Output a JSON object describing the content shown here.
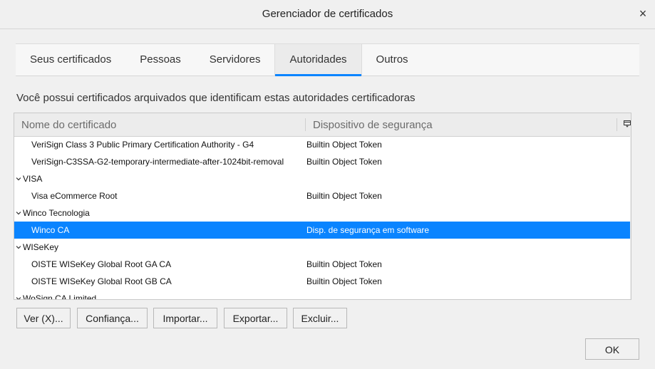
{
  "window": {
    "title": "Gerenciador de certificados",
    "close_label": "×"
  },
  "tabs": [
    {
      "label": "Seus certificados",
      "active": false
    },
    {
      "label": "Pessoas",
      "active": false
    },
    {
      "label": "Servidores",
      "active": false
    },
    {
      "label": "Autoridades",
      "active": true
    },
    {
      "label": "Outros",
      "active": false
    }
  ],
  "description": "Você possui certificados arquivados que identificam estas autoridades certificadoras",
  "table": {
    "columns": [
      "Nome do certificado",
      "Dispositivo de segurança"
    ],
    "rows": [
      {
        "type": "item",
        "name": "VeriSign Class 3 Public Primary Certification Authority - G4",
        "device": "Builtin Object Token",
        "selected": false
      },
      {
        "type": "item",
        "name": "VeriSign-C3SSA-G2-temporary-intermediate-after-1024bit-removal",
        "device": "Builtin Object Token",
        "selected": false
      },
      {
        "type": "group",
        "name": "VISA",
        "device": "",
        "selected": false
      },
      {
        "type": "item",
        "name": "Visa eCommerce Root",
        "device": "Builtin Object Token",
        "selected": false
      },
      {
        "type": "group",
        "name": "Winco Tecnologia",
        "device": "",
        "selected": false
      },
      {
        "type": "item",
        "name": "Winco CA",
        "device": "Disp. de segurança em software",
        "selected": true
      },
      {
        "type": "group",
        "name": "WISeKey",
        "device": "",
        "selected": false
      },
      {
        "type": "item",
        "name": "OISTE WISeKey Global Root GA CA",
        "device": "Builtin Object Token",
        "selected": false
      },
      {
        "type": "item",
        "name": "OISTE WISeKey Global Root GB CA",
        "device": "Builtin Object Token",
        "selected": false
      },
      {
        "type": "group",
        "name": "WoSign CA Limited",
        "device": "",
        "selected": false
      }
    ]
  },
  "buttons": {
    "view": "Ver (X)...",
    "trust": "Confiança...",
    "import": "Importar...",
    "export": "Exportar...",
    "delete": "Excluir...",
    "ok": "OK"
  },
  "colors": {
    "accent": "#0a84ff",
    "selected_text": "#ffffff"
  }
}
